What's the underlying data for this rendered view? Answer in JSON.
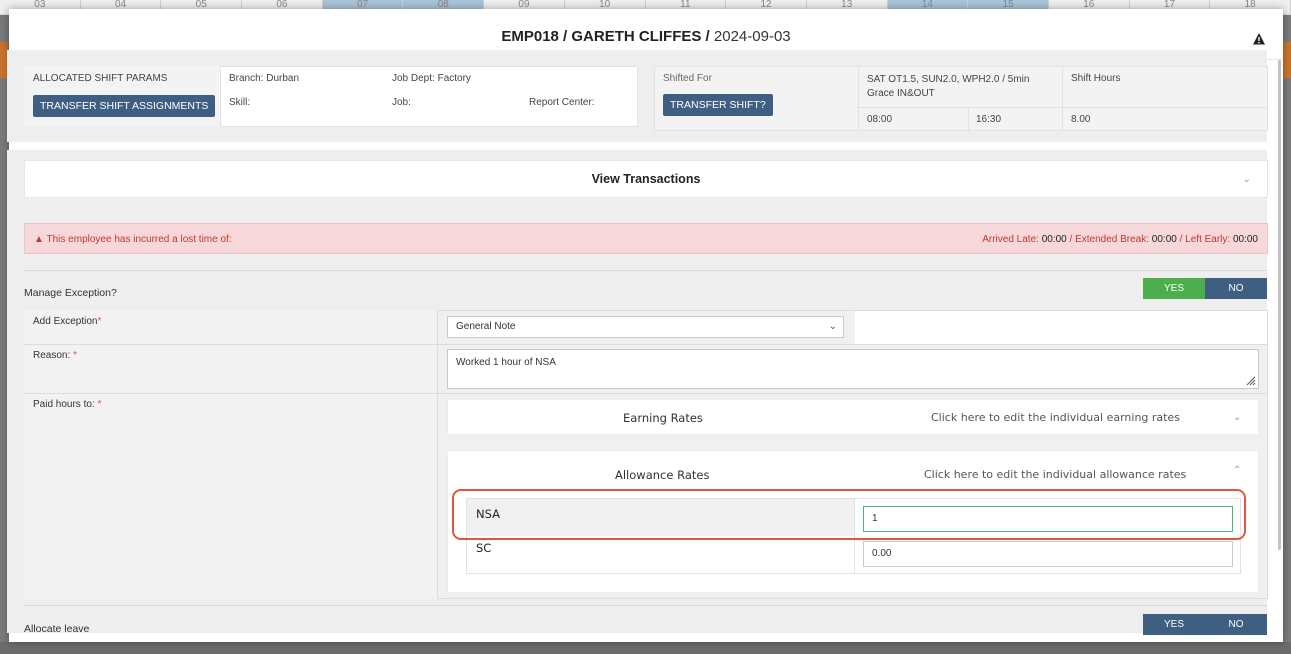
{
  "background": {
    "day_numbers": [
      "03",
      "04",
      "05",
      "06",
      "07",
      "08",
      "09",
      "10",
      "11",
      "12",
      "13",
      "14",
      "15",
      "16",
      "17",
      "18"
    ]
  },
  "header": {
    "employee": "EMP018 / GARETH CLIFFES /",
    "date": "2024-09-03"
  },
  "params": {
    "allocated_label": "ALLOCATED SHIFT PARAMS",
    "transfer_assignments": "TRANSFER SHIFT ASSIGNMENTS",
    "branch": "Branch: Durban",
    "job_dept": "Job Dept: Factory",
    "skill": "Skill:",
    "job": "Job:",
    "report_center": "Report Center:",
    "shifted_for": "Shifted For",
    "transfer_shift": "TRANSFER SHIFT?",
    "shift_desc": "SAT OT1.5, SUN2.0, WPH2.0 / 5min Grace IN&OUT",
    "shift_hours_label": "Shift Hours",
    "start": "08:00",
    "end": "16:30",
    "hours": "8.00"
  },
  "transactions": {
    "label": "View Transactions"
  },
  "alert": {
    "message": "This employee has incurred a lost time of:",
    "late_label": "Arrived Late:",
    "late": "00:00",
    "break_label": "/ Extended Break:",
    "break": "00:00",
    "early_label": "/ Left Early:",
    "early": "00:00"
  },
  "manage_exception": {
    "label": "Manage Exception?",
    "yes": "YES",
    "no": "NO"
  },
  "form": {
    "add_exception_label": "Add Exception",
    "add_exception_value": "General Note",
    "reason_label": "Reason:",
    "reason_value": "Worked 1 hour of NSA",
    "paid_hours_label": "Paid hours to:",
    "required_mark": "*"
  },
  "earning": {
    "title": "Earning Rates",
    "hint": "Click here to edit the individual earning rates"
  },
  "allowance": {
    "title": "Allowance Rates",
    "hint": "Click here to edit the individual allowance rates",
    "rows": [
      {
        "label": "NSA",
        "value": "1"
      },
      {
        "label": "SC",
        "value": "0.00"
      }
    ]
  },
  "allocate_leave": {
    "label": "Allocate leave",
    "yes": "YES",
    "no": "NO"
  },
  "colors": {
    "primary": "#3e5f82",
    "success": "#4cae4c",
    "alert_bg": "#f6d8db",
    "highlight": "#e0573e"
  }
}
